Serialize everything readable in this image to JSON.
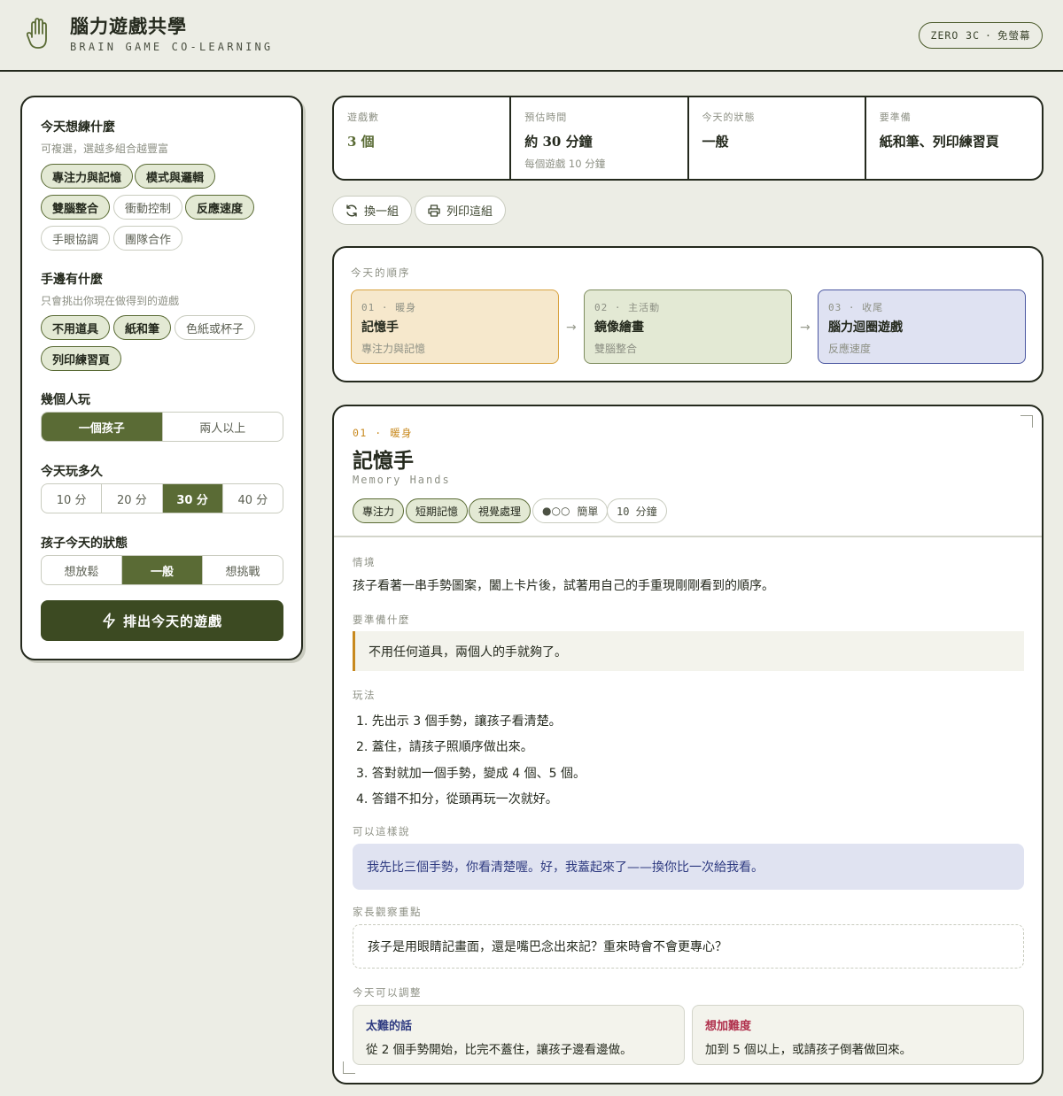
{
  "header": {
    "title": "腦力遊戲共學",
    "subtitle": "BRAIN GAME CO-LEARNING",
    "badge_left": "ZERO 3C",
    "badge_sep": "·",
    "badge_right": "免螢幕"
  },
  "sidebar": {
    "goals": {
      "title": "今天想練什麼",
      "hint": "可複選，選越多組合越豐富",
      "options": [
        {
          "label": "專注力與記憶",
          "selected": true
        },
        {
          "label": "模式與邏輯",
          "selected": true
        },
        {
          "label": "雙腦整合",
          "selected": true
        },
        {
          "label": "衝動控制",
          "selected": false
        },
        {
          "label": "反應速度",
          "selected": true
        },
        {
          "label": "手眼協調",
          "selected": false
        },
        {
          "label": "團隊合作",
          "selected": false
        }
      ]
    },
    "materials": {
      "title": "手邊有什麼",
      "hint": "只會挑出你現在做得到的遊戲",
      "options": [
        {
          "label": "不用道具",
          "selected": true
        },
        {
          "label": "紙和筆",
          "selected": true
        },
        {
          "label": "色紙或杯子",
          "selected": false
        },
        {
          "label": "列印練習頁",
          "selected": true
        }
      ]
    },
    "players": {
      "title": "幾個人玩",
      "options": [
        "一個孩子",
        "兩人以上"
      ],
      "selected": "一個孩子"
    },
    "duration": {
      "title": "今天玩多久",
      "options": [
        "10 分",
        "20 分",
        "30 分",
        "40 分"
      ],
      "selected": "30 分"
    },
    "mood": {
      "title": "孩子今天的狀態",
      "options": [
        "想放鬆",
        "一般",
        "想挑戰"
      ],
      "selected": "一般"
    },
    "generate_label": "排出今天的遊戲"
  },
  "stats": [
    {
      "label": "遊戲數",
      "value": "3 個",
      "sub": ""
    },
    {
      "label": "預估時間",
      "value": "約 30 分鐘",
      "sub": "每個遊戲 10 分鐘"
    },
    {
      "label": "今天的狀態",
      "value": "一般",
      "sub": ""
    },
    {
      "label": "要準備",
      "value": "紙和筆、列印練習頁",
      "sub": ""
    }
  ],
  "actions": {
    "shuffle_label": "換一組",
    "print_label": "列印這組"
  },
  "order": {
    "label": "今天的順序",
    "steps": [
      {
        "tag": "01 · 暖身",
        "name": "記憶手",
        "skill": "專注力與記憶"
      },
      {
        "tag": "02 · 主活動",
        "name": "鏡像繪畫",
        "skill": "雙腦整合"
      },
      {
        "tag": "03 · 收尾",
        "name": "腦力迴圈遊戲",
        "skill": "反應速度"
      }
    ]
  },
  "detail": {
    "tag": "01 · 暖身",
    "title": "記憶手",
    "english": "Memory Hands",
    "chips": [
      "專注力",
      "短期記憶",
      "視覺處理"
    ],
    "difficulty_dots": "●○○",
    "difficulty": "簡單",
    "time": "10 分鐘",
    "scenario_label": "情境",
    "scenario": "孩子看著一串手勢圖案，闔上卡片後，試著用自己的手重現剛剛看到的順序。",
    "prep_label": "要準備什麼",
    "prep": "不用任何道具，兩個人的手就夠了。",
    "howto_label": "玩法",
    "steps": [
      "1. 先出示 3 個手勢，讓孩子看清楚。",
      "2. 蓋住，請孩子照順序做出來。",
      "3. 答對就加一個手勢，變成 4 個、5 個。",
      "4. 答錯不扣分，從頭再玩一次就好。"
    ],
    "say_label": "可以這樣說",
    "say": "我先比三個手勢，你看清楚喔。好，我蓋起來了——換你比一次給我看。",
    "observe_label": "家長觀察重點",
    "observe": "孩子是用眼睛記畫面，還是嘴巴念出來記？重來時會不會更專心？",
    "adjust_label": "今天可以調整",
    "easier_title": "太難的話",
    "easier": "從 2 個手勢開始，比完不蓋住，讓孩子邊看邊做。",
    "harder_title": "想加難度",
    "harder": "加到 5 個以上，或請孩子倒著做回來。"
  },
  "colors": {
    "accent_green": "#5a6b35",
    "dark_green": "#3c4a22",
    "warmup_bg": "#f6e8cc",
    "warmup_border": "#d8a23f",
    "main_bg": "#e3e9d4",
    "main_border": "#7e8c5e",
    "finish_bg": "#dfe2f2",
    "finish_border": "#4a56a0",
    "orange_tag": "#c8891e",
    "easier_color": "#2e3a80",
    "harder_color": "#b0304c"
  }
}
